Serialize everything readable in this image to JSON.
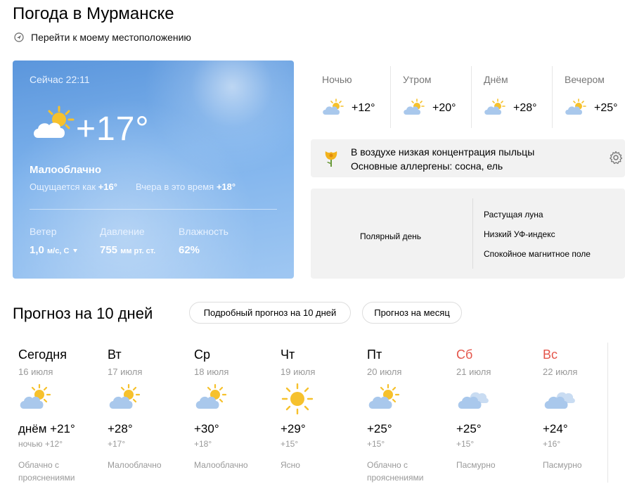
{
  "title": "Погода в Мурманске",
  "geo_link": "Перейти к моему местоположению",
  "now": {
    "time": "Сейчас 22:11",
    "temp": "+17°",
    "condition": "Малооблачно",
    "feels_label": "Ощущается как",
    "feels_value": "+16°",
    "yesterday_label": "Вчера в это время",
    "yesterday_value": "+18°",
    "wind_label": "Ветер",
    "wind_value": "1,0",
    "wind_unit": "м/с, С",
    "pressure_label": "Давление",
    "pressure_value": "755",
    "pressure_unit": "мм рт. ст.",
    "humidity_label": "Влажность",
    "humidity_value": "62%",
    "icon": "partly-cloudy-icon"
  },
  "day_parts": [
    {
      "label": "Ночью",
      "temp": "+12°",
      "icon": "partly-cloudy-icon"
    },
    {
      "label": "Утром",
      "temp": "+20°",
      "icon": "partly-cloudy-icon"
    },
    {
      "label": "Днём",
      "temp": "+28°",
      "icon": "partly-cloudy-icon"
    },
    {
      "label": "Вечером",
      "temp": "+25°",
      "icon": "partly-cloudy-icon"
    }
  ],
  "pollen": {
    "line1": "В воздухе низкая концентрация пыльцы",
    "line2": "Основные аллергены: сосна, ель"
  },
  "info": {
    "polar": "Полярный день",
    "moon": "Растущая луна",
    "uv": "Низкий УФ-индекс",
    "magnetic": "Спокойное магнитное поле"
  },
  "forecast": {
    "title": "Прогноз на 10 дней",
    "btn_detailed": "Подробный прогноз на 10 дней",
    "btn_month": "Прогноз на месяц",
    "days": [
      {
        "name": "Сегодня",
        "date": "16 июля",
        "temp": "днём +21°",
        "night": "ночью +12°",
        "cond": "Облачно с прояснениями",
        "weekend": false,
        "icon": "partly-cloudy-icon"
      },
      {
        "name": "Вт",
        "date": "17 июля",
        "temp": "+28°",
        "night": "+17°",
        "cond": "Малооблачно",
        "weekend": false,
        "icon": "partly-cloudy-icon"
      },
      {
        "name": "Ср",
        "date": "18 июля",
        "temp": "+30°",
        "night": "+18°",
        "cond": "Малооблачно",
        "weekend": false,
        "icon": "partly-cloudy-icon"
      },
      {
        "name": "Чт",
        "date": "19 июля",
        "temp": "+29°",
        "night": "+15°",
        "cond": "Ясно",
        "weekend": false,
        "icon": "sun-icon"
      },
      {
        "name": "Пт",
        "date": "20 июля",
        "temp": "+25°",
        "night": "+15°",
        "cond": "Облачно с прояснениями",
        "weekend": false,
        "icon": "partly-cloudy-icon"
      },
      {
        "name": "Сб",
        "date": "21 июля",
        "temp": "+25°",
        "night": "+15°",
        "cond": "Пасмурно",
        "weekend": true,
        "icon": "cloudy-icon"
      },
      {
        "name": "Вс",
        "date": "22 июля",
        "temp": "+24°",
        "night": "+16°",
        "cond": "Пасмурно",
        "weekend": true,
        "icon": "cloudy-icon"
      }
    ]
  },
  "colors": {
    "weekend": "#e4564b",
    "sun": "#f6c12c",
    "cloud": "#a9c8ec",
    "card": "#6fa6e6"
  }
}
